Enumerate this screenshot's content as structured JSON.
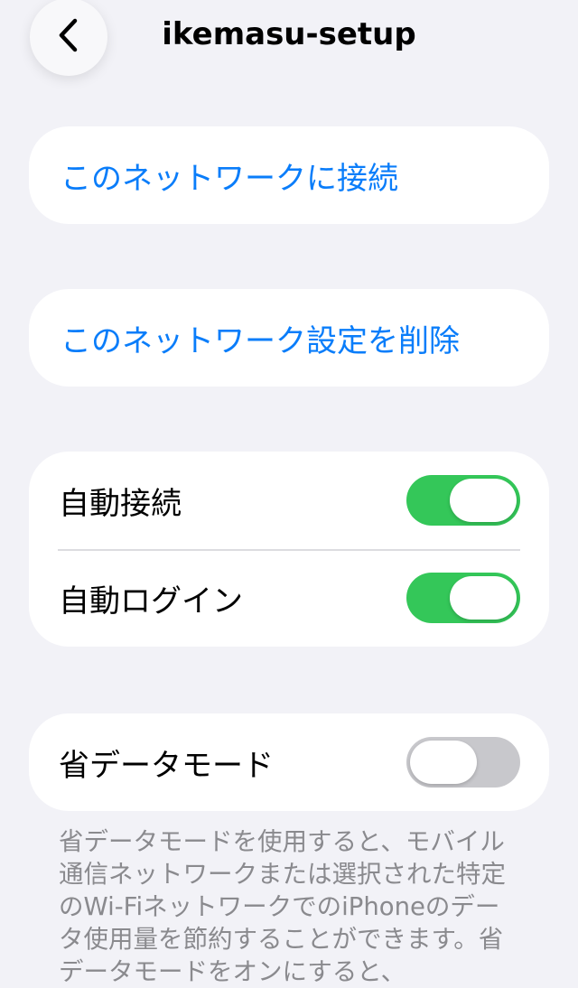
{
  "nav": {
    "title": "ikemasu-setup",
    "back_icon": "chevron-left-icon"
  },
  "actions": {
    "connect_label": "このネットワークに接続",
    "forget_label": "このネットワーク設定を削除"
  },
  "auto_settings": {
    "auto_join_label": "自動接続",
    "auto_join_on": true,
    "auto_login_label": "自動ログイン",
    "auto_login_on": true
  },
  "low_data": {
    "label": "省データモード",
    "on": false,
    "description": "省データモードを使用すると、モバイル通信ネットワークまたは選択された特定のWi-FiネットワークでのiPhoneのデータ使用量を節約することができます。省データモードをオンにすると、"
  },
  "colors": {
    "background": "#f2f2f7",
    "accent": "#0a7dfa",
    "toggle_on": "#34c759",
    "toggle_off": "#c8c8cc",
    "secondary_text": "#8a8a8e"
  }
}
